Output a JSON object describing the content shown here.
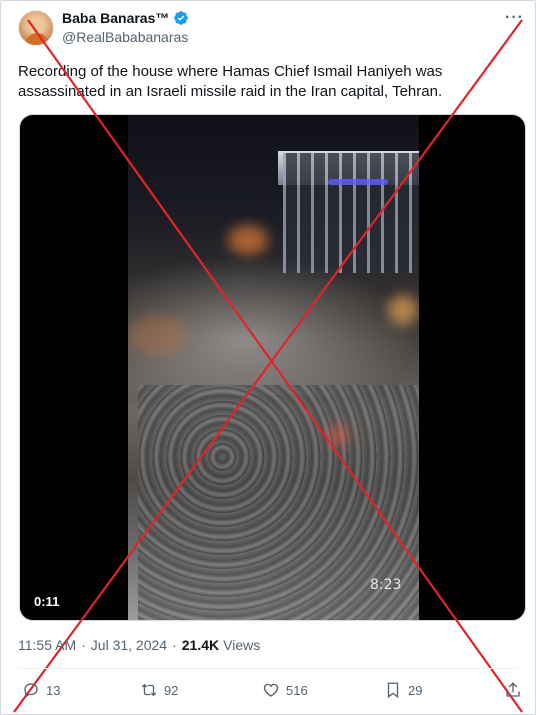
{
  "author": {
    "display_name": "Baba Banaras™",
    "handle": "@RealBababanaras",
    "verified": true
  },
  "tweet": {
    "text": "Recording of the house where Hamas Chief Ismail Haniyeh was assassinated in an Israeli missile raid in the Iran capital, Tehran.",
    "time": "11:55 AM",
    "date": "Jul 31, 2024",
    "views_count": "21.4K",
    "views_label": "Views"
  },
  "media": {
    "duration": "0:11",
    "overlay_text": "8:23"
  },
  "actions": {
    "replies": "13",
    "retweets": "92",
    "likes": "516",
    "bookmarks": "29"
  },
  "colors": {
    "accent": "#1d9bf0",
    "secondary_text": "#536471",
    "primary_text": "#0f1419",
    "cross_mark": "#e0242b"
  },
  "icons": [
    "more-icon",
    "verified-icon",
    "reply-icon",
    "retweet-icon",
    "like-icon",
    "bookmark-icon",
    "share-icon"
  ]
}
